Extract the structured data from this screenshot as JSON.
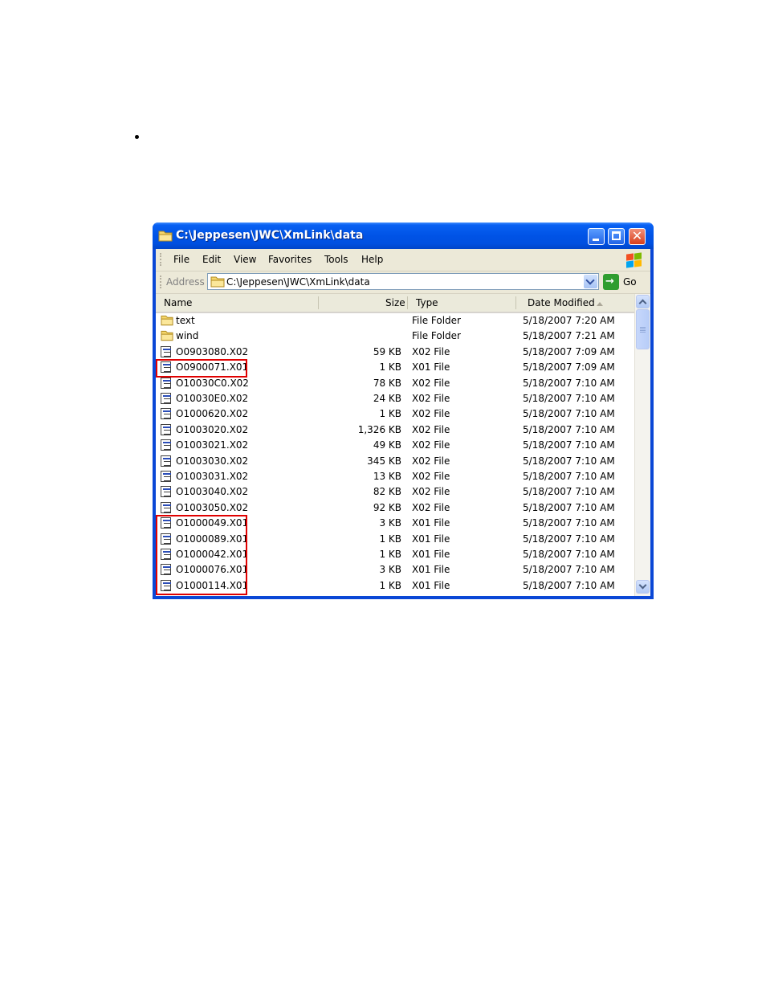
{
  "window": {
    "title": "C:\\Jeppesen\\JWC\\XmLink\\data"
  },
  "menu": {
    "items": [
      "File",
      "Edit",
      "View",
      "Favorites",
      "Tools",
      "Help"
    ]
  },
  "address": {
    "label": "Address",
    "value": "C:\\Jeppesen\\JWC\\XmLink\\data",
    "go_label": "Go"
  },
  "columns": {
    "name": "Name",
    "size": "Size",
    "type": "Type",
    "date": "Date Modified"
  },
  "files": [
    {
      "name": "text",
      "size": "",
      "type": "File Folder",
      "date": "5/18/2007 7:20 AM",
      "kind": "folder-icon"
    },
    {
      "name": "wind",
      "size": "",
      "type": "File Folder",
      "date": "5/18/2007 7:21 AM",
      "kind": "folder-icon"
    },
    {
      "name": "O0903080.X02",
      "size": "59 KB",
      "type": "X02 File",
      "date": "5/18/2007 7:09 AM",
      "kind": "file-icon"
    },
    {
      "name": "O0900071.X01",
      "size": "1 KB",
      "type": "X01 File",
      "date": "5/18/2007 7:09 AM",
      "kind": "file-icon"
    },
    {
      "name": "O10030C0.X02",
      "size": "78 KB",
      "type": "X02 File",
      "date": "5/18/2007 7:10 AM",
      "kind": "file-icon"
    },
    {
      "name": "O10030E0.X02",
      "size": "24 KB",
      "type": "X02 File",
      "date": "5/18/2007 7:10 AM",
      "kind": "file-icon"
    },
    {
      "name": "O1000620.X02",
      "size": "1 KB",
      "type": "X02 File",
      "date": "5/18/2007 7:10 AM",
      "kind": "file-icon"
    },
    {
      "name": "O1003020.X02",
      "size": "1,326 KB",
      "type": "X02 File",
      "date": "5/18/2007 7:10 AM",
      "kind": "file-icon"
    },
    {
      "name": "O1003021.X02",
      "size": "49 KB",
      "type": "X02 File",
      "date": "5/18/2007 7:10 AM",
      "kind": "file-icon"
    },
    {
      "name": "O1003030.X02",
      "size": "345 KB",
      "type": "X02 File",
      "date": "5/18/2007 7:10 AM",
      "kind": "file-icon"
    },
    {
      "name": "O1003031.X02",
      "size": "13 KB",
      "type": "X02 File",
      "date": "5/18/2007 7:10 AM",
      "kind": "file-icon"
    },
    {
      "name": "O1003040.X02",
      "size": "82 KB",
      "type": "X02 File",
      "date": "5/18/2007 7:10 AM",
      "kind": "file-icon"
    },
    {
      "name": "O1003050.X02",
      "size": "92 KB",
      "type": "X02 File",
      "date": "5/18/2007 7:10 AM",
      "kind": "file-icon"
    },
    {
      "name": "O1000049.X01",
      "size": "3 KB",
      "type": "X01 File",
      "date": "5/18/2007 7:10 AM",
      "kind": "file-icon"
    },
    {
      "name": "O1000089.X01",
      "size": "1 KB",
      "type": "X01 File",
      "date": "5/18/2007 7:10 AM",
      "kind": "file-icon"
    },
    {
      "name": "O1000042.X01",
      "size": "1 KB",
      "type": "X01 File",
      "date": "5/18/2007 7:10 AM",
      "kind": "file-icon"
    },
    {
      "name": "O1000076.X01",
      "size": "3 KB",
      "type": "X01 File",
      "date": "5/18/2007 7:10 AM",
      "kind": "file-icon"
    },
    {
      "name": "O1000114.X01",
      "size": "1 KB",
      "type": "X01 File",
      "date": "5/18/2007 7:10 AM",
      "kind": "file-icon"
    }
  ],
  "highlights": [
    {
      "first_row": 3,
      "last_row": 3
    },
    {
      "first_row": 13,
      "last_row": 17
    }
  ],
  "colors": {
    "titlebar": "#0053e6",
    "highlight": "#e00000"
  }
}
